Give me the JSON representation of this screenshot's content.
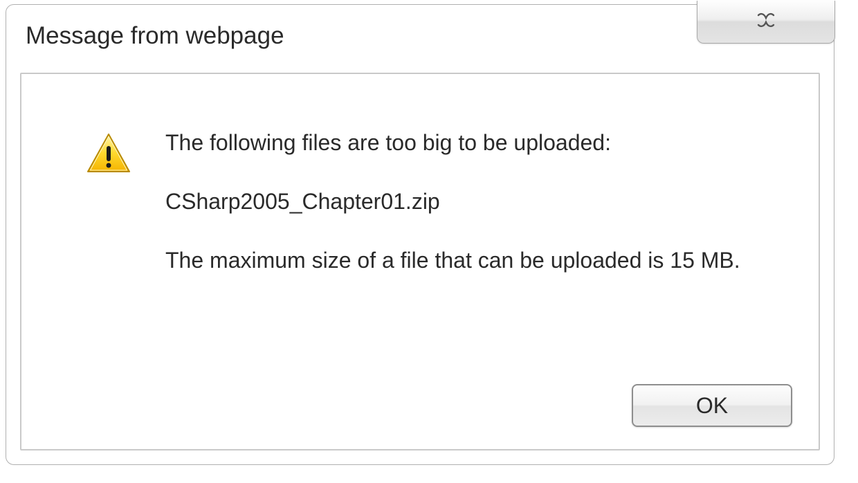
{
  "dialog": {
    "title": "Message from webpage",
    "message_line1": "The following files are too big to be uploaded:",
    "file_name": "CSharp2005_Chapter01.zip",
    "message_line2": "The maximum size of a file that can be uploaded is 15 MB.",
    "ok_label": "OK"
  }
}
